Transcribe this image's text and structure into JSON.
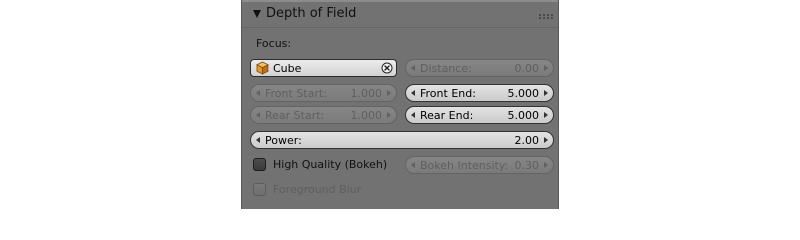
{
  "panel": {
    "title": "Depth of Field",
    "focus_label": "Focus:",
    "focus_object": {
      "name": "Cube"
    },
    "distance": {
      "label": "Distance:",
      "value": "0.00",
      "enabled": false
    },
    "front_start": {
      "label": "Front Start:",
      "value": "1.000",
      "enabled": false
    },
    "front_end": {
      "label": "Front End:",
      "value": "5.000",
      "enabled": true
    },
    "rear_start": {
      "label": "Rear Start:",
      "value": "1.000",
      "enabled": false
    },
    "rear_end": {
      "label": "Rear End:",
      "value": "5.000",
      "enabled": true
    },
    "power": {
      "label": "Power:",
      "value": "2.00",
      "enabled": true
    },
    "high_quality": {
      "label": "High Quality (Bokeh)",
      "checked": false
    },
    "bokeh_intensity": {
      "label": "Bokeh Intensity:",
      "value": "0.30",
      "enabled": false
    },
    "foreground_blur": {
      "label": "Foreground Blur",
      "checked": false,
      "enabled": false
    }
  },
  "colors": {
    "panel_bg": "#727272",
    "field_light": "#dcdcdc",
    "field_disabled": "#818181",
    "checkbox": "#444444",
    "cube_icon": "#e39a2a"
  },
  "icons": {
    "header_collapse": "disclosure-triangle-down-icon",
    "drag_handle": "grip-dots-icon",
    "object": "cube-icon",
    "clear": "x-circle-icon"
  }
}
